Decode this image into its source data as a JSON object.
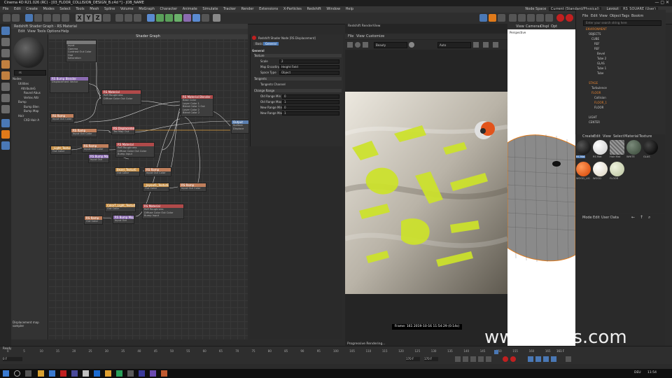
{
  "window": {
    "title": "Cinema 4D R21.026 (RC) - [03_FLOOR_COLLISION_DESIGN_B.c4d *] - JOB_NAME",
    "controls": "—  ▢  ✕"
  },
  "menubar": {
    "items": [
      "File",
      "Edit",
      "Create",
      "Modes",
      "Select",
      "Tools",
      "Mesh",
      "Spline",
      "Volume",
      "MoGraph",
      "Character",
      "Animate",
      "Simulate",
      "Tracker",
      "Render",
      "Extensions",
      "X-Particles",
      "Redshift",
      "Window",
      "Help"
    ],
    "node_space_label": "Node Space",
    "node_space_value": "Current (Standard/Physical)",
    "layout_label": "Layout",
    "layout_value": "RS_SQUARE (User)"
  },
  "shader_graph": {
    "window_title": "Redshift Shader Graph - RS Material",
    "menu": [
      "Edit",
      "View",
      "Tools",
      "Options",
      "Help"
    ],
    "graph_title": "Shader Graph",
    "search_value": "rs",
    "tree_title": "Nodes",
    "tree": [
      "Utilities",
      "AttributeG",
      "Round Abus",
      "Vertex Attr",
      "Bump",
      "Bump Blen",
      "Bump Map",
      "Hair",
      "CXD Hair A"
    ],
    "description": "Displacement map sampler",
    "nodes": [
      {
        "title": "",
        "color": "#7a7a7a",
        "rows": [
          "Input",
          "Gamma",
          "Contrast  Out Color",
          "Hue",
          "Saturation"
        ]
      },
      {
        "title": "RS Bump Blender",
        "color": "#8a6bb0",
        "rows": [
          "",
          "Displacement Vector",
          ""
        ]
      },
      {
        "title": "RS Material",
        "color": "#b04a4a",
        "rows": [
          "",
          "Refl Roughness",
          "Diffuse Color   Out Color"
        ]
      },
      {
        "title": "RS Material Blender",
        "color": "#b04a4a",
        "rows": [
          "Base Color",
          "Layer Color 1",
          "Blend Color 1   Out",
          "Layer Color 2",
          "Blend Color 2"
        ]
      },
      {
        "title": "RS Ramp",
        "color": "#c07f5c",
        "rows": [
          "Input Out Color"
        ]
      },
      {
        "title": "RS Ramp",
        "color": "#c07f5c",
        "rows": [
          "Input Out Color"
        ]
      },
      {
        "title": "RS Displacement",
        "color": "#c06060",
        "rows": [
          "Tex Map   Out"
        ]
      },
      {
        "title": "Output",
        "color": "#5b7fb0",
        "rows": [
          "Surface",
          "Displace"
        ]
      },
      {
        "title": "_Light_TexturE",
        "color": "#c8924a",
        "rows": [
          "Out Color"
        ]
      },
      {
        "title": "RS Ramp",
        "color": "#c07f5c",
        "rows": [
          "Input Out Color"
        ]
      },
      {
        "title": "RS Material",
        "color": "#b04a4a",
        "rows": [
          "Refl Roughness",
          "Diffuse Color   Out Color",
          "Bump Input"
        ]
      },
      {
        "title": "RS Bump Map",
        "color": "#8a6bb0",
        "rows": [
          "Input   Out"
        ]
      },
      {
        "title": "Bezel_TexturE",
        "color": "#c8924a",
        "rows": [
          "Out Color"
        ]
      },
      {
        "title": "RS Ramp",
        "color": "#c07f5c",
        "rows": [
          "Input Out Color"
        ]
      },
      {
        "title": "_Jayout1_TexturE",
        "color": "#c8924a",
        "rows": [
          "Out Color"
        ]
      },
      {
        "title": "RS Ramp",
        "color": "#c07f5c",
        "rows": [
          "Input Out Color"
        ]
      },
      {
        "title": "ColorT_Light_TexturE",
        "color": "#c8924a",
        "rows": [
          "Out Color"
        ]
      },
      {
        "title": "RS Material",
        "color": "#b04a4a",
        "rows": [
          "Refl Roughness",
          "Diffuse Color   Out Color",
          "Bump Input"
        ]
      },
      {
        "title": "RS Bump Map",
        "color": "#8a6bb0",
        "rows": [
          "Input   Out"
        ]
      },
      {
        "title": "RS Ramp",
        "color": "#c07f5c",
        "rows": [
          "Out Color"
        ]
      }
    ]
  },
  "attributes": {
    "title": "Redshift Shader Node [RS Displacement]",
    "tabs": [
      "Basic",
      "General"
    ],
    "section_general": "General",
    "section_texture": "Texture",
    "rows": [
      {
        "label": "Scale",
        "value": "2"
      },
      {
        "label": "Map Encoding",
        "value": "Height Field"
      },
      {
        "label": "Space Type",
        "value": "Object"
      }
    ],
    "section_tangents": "Tangents",
    "tangents_channel": "Tangents Channel",
    "section_range": "Change Range",
    "range_rows": [
      {
        "label": "Old Range Min",
        "value": "0"
      },
      {
        "label": "Old Range Max",
        "value": "1"
      },
      {
        "label": "New Range Min",
        "value": "0"
      },
      {
        "label": "New Range Max",
        "value": "1"
      }
    ]
  },
  "render_view": {
    "title": "Redshift RenderView",
    "menu": [
      "File",
      "View",
      "Customize"
    ],
    "aov": "Beauty",
    "camera": "Auto",
    "frame_info": "Frame: 161  2019-10-16  11:54:29  (0:14s)",
    "status": "Progressive Rendering..."
  },
  "viewport": {
    "menu": [
      "View",
      "Cameras",
      "Displ",
      "Opt"
    ],
    "label": "Perspective"
  },
  "object_manager": {
    "menu": [
      "File",
      "Edit",
      "View",
      "Object",
      "Tags",
      "Bookm"
    ],
    "search_placeholder": "Enter your search string here",
    "items": [
      "ENVIRONMENT",
      "OBJECTS",
      "CUBE",
      "REF",
      "REF",
      "Bevel",
      "Tube 2",
      "GLAS",
      "Tube 1",
      "Tube",
      "STAGE",
      "Turbulence",
      "FLOOR",
      "Collision",
      "FLOOR_1",
      "FLOOR",
      "LIGHT",
      "CENTER"
    ]
  },
  "material_manager": {
    "menu": [
      "Create",
      "Edit",
      "View",
      "Select",
      "Material",
      "Texture"
    ],
    "materials": [
      {
        "name": "RS Mat",
        "color": "#1a1a1a"
      },
      {
        "name": "RS Mat",
        "color": "#d8d8d8"
      },
      {
        "name": "Hair Mat",
        "color": "#8a8a8a"
      },
      {
        "name": "WHITE",
        "color": "#4a5a4a"
      },
      {
        "name": "GLAS",
        "color": "#101010"
      },
      {
        "name": "WOOD_LIG",
        "color": "#e05a1a"
      },
      {
        "name": "WOOD",
        "color": "#e6e0d0"
      },
      {
        "name": "FLOOR",
        "color": "#c8d0b0"
      }
    ]
  },
  "attribute_manager": {
    "menu": [
      "Mode",
      "Edit",
      "User Data"
    ]
  },
  "timeline": {
    "ticks": [
      "0",
      "5",
      "10",
      "15",
      "20",
      "25",
      "30",
      "35",
      "40",
      "45",
      "50",
      "55",
      "60",
      "65",
      "70",
      "75",
      "80",
      "85",
      "90",
      "95",
      "100",
      "105",
      "110",
      "115",
      "120",
      "125",
      "130",
      "135",
      "140",
      "145",
      "150",
      "155",
      "160",
      "165"
    ],
    "current_frame": "161 F",
    "start": "0 F",
    "end": "170 F",
    "end2": "170 F"
  },
  "status": {
    "ready": "Ready"
  },
  "taskbar": {
    "time": "11:54",
    "lang": "DEU"
  },
  "watermark": {
    "text": "www.hunls.com"
  }
}
